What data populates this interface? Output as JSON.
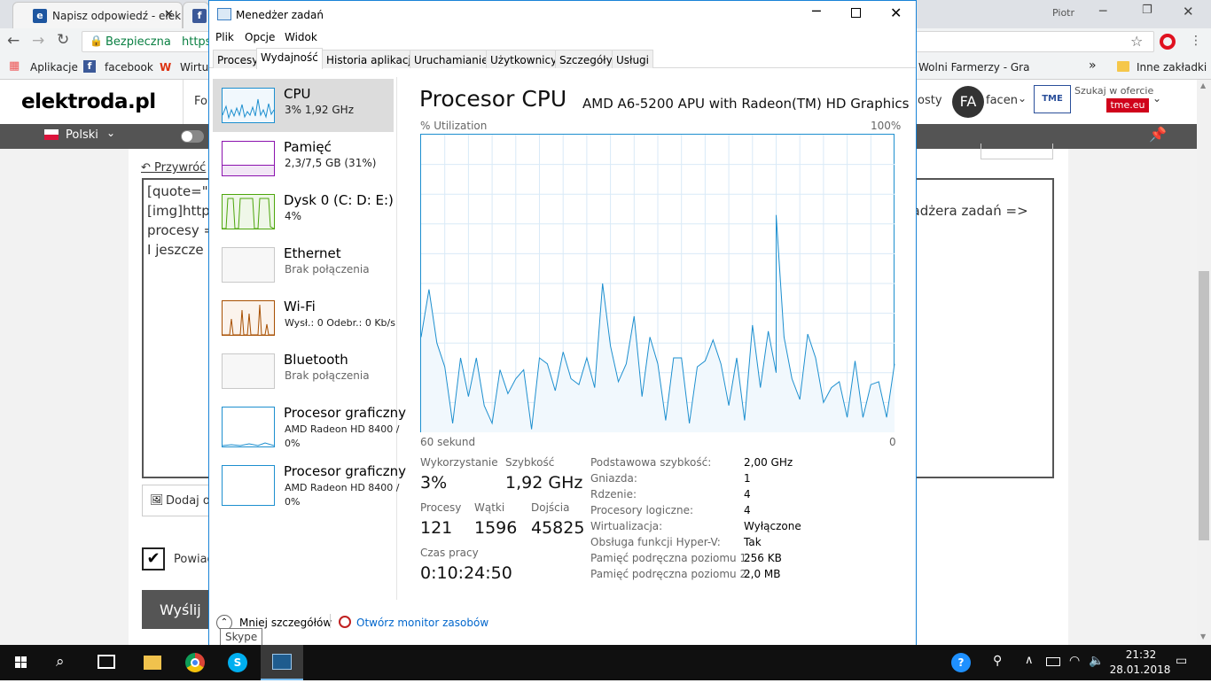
{
  "chrome": {
    "tabs": [
      {
        "title": "Napisz odpowiedź - elek"
      },
      {
        "title": "f"
      }
    ],
    "user": "Piotr",
    "secure_label": "Bezpieczna",
    "url_fragment": "https",
    "bookmarks": {
      "apps": "Aplikacje",
      "facebook": "facebook",
      "wirtua": "Wirtua",
      "wolni": "Wolni Farmerzy - Gra",
      "more": "»",
      "other": "Inne zakładki"
    }
  },
  "site": {
    "logo": "elektroda.pl",
    "nav_fo": "Fo",
    "nav_osty": "osty",
    "avatar": "FA",
    "username": "facen",
    "tme_search": "Szukaj w ofercie",
    "tme_badge": "tme.eu",
    "language": "Polski",
    "back_link": "Przywróć",
    "textarea_lines": [
      "[quote=\"fa",
      "[img]https",
      "procesy = ",
      "I jeszcze d"
    ],
    "textarea_tail": "nadżera zadań =>",
    "attach_label": "Dodaj o",
    "notify_label": "Powiad",
    "submit_label": "Wyślij"
  },
  "taskmgr": {
    "title": "Menedżer zadań",
    "menu": [
      "Plik",
      "Opcje",
      "Widok"
    ],
    "tabs": [
      "Procesy",
      "Wydajność",
      "Historia aplikacji",
      "Uruchamianie",
      "Użytkownicy",
      "Szczegóły",
      "Usługi"
    ],
    "sidebar": {
      "cpu": {
        "name": "CPU",
        "sub": "3%  1,92 GHz"
      },
      "memory": {
        "name": "Pamięć",
        "sub": "2,3/7,5 GB (31%)"
      },
      "disk": {
        "name": "Dysk 0 (C: D: E:)",
        "sub": "4%"
      },
      "ethernet": {
        "name": "Ethernet",
        "sub": "Brak połączenia"
      },
      "wifi": {
        "name": "Wi-Fi",
        "sub": "Wysł.: 0  Odebr.: 0 Kb/s"
      },
      "bluetooth": {
        "name": "Bluetooth",
        "sub": "Brak połączenia"
      },
      "gpu0": {
        "name": "Procesor graficzny",
        "model": "AMD Radeon HD 8400 /",
        "sub": "0%"
      },
      "gpu1": {
        "name": "Procesor graficzny",
        "model": "AMD Radeon HD 8400 /",
        "sub": "0%"
      }
    },
    "main": {
      "heading": "Procesor CPU",
      "model": "AMD A6-5200 APU with Radeon(TM) HD Graphics",
      "util_label": "% Utilization",
      "util_max": "100%",
      "time_label": "60 sekund",
      "time_min": "0",
      "stats": {
        "usage_label": "Wykorzystanie",
        "usage": "3%",
        "speed_label": "Szybkość",
        "speed": "1,92 GHz",
        "proc_label": "Procesy",
        "proc": "121",
        "threads_label": "Wątki",
        "threads": "1596",
        "handles_label": "Dojścia",
        "handles": "45825",
        "uptime_label": "Czas pracy",
        "uptime": "0:10:24:50"
      },
      "details": [
        {
          "k": "Podstawowa szybkość:",
          "v": "2,00 GHz"
        },
        {
          "k": "Gniazda:",
          "v": "1"
        },
        {
          "k": "Rdzenie:",
          "v": "4"
        },
        {
          "k": "Procesory logiczne:",
          "v": "4"
        },
        {
          "k": "Wirtualizacja:",
          "v": "Wyłączone"
        },
        {
          "k": "Obsługa funkcji Hyper-V:",
          "v": "Tak"
        },
        {
          "k": "Pamięć podręczna poziomu 1:",
          "v": "256 KB"
        },
        {
          "k": "Pamięć podręczna poziomu 2:",
          "v": "2,0 MB"
        }
      ]
    },
    "footer": {
      "less": "Mniej szczegółów",
      "monitor": "Otwórz monitor zasobów"
    },
    "tooltip": "Skype"
  },
  "chart_data": {
    "type": "area",
    "x": [
      60,
      59,
      58,
      57,
      56,
      55,
      54,
      53,
      52,
      51,
      50,
      49,
      48,
      47,
      46,
      45,
      44,
      43,
      42,
      41,
      40,
      39,
      38,
      37,
      36,
      35,
      34,
      33,
      32,
      31,
      30,
      29,
      28,
      27,
      26,
      25,
      24,
      23,
      22,
      21,
      20,
      19,
      18,
      17,
      16,
      15,
      15,
      14,
      13,
      12,
      11,
      10,
      9,
      8,
      7,
      6,
      5,
      4,
      3,
      2,
      1,
      0
    ],
    "values": [
      32,
      48,
      30,
      22,
      3,
      25,
      12,
      25,
      9,
      3,
      21,
      13,
      18,
      21,
      1,
      25,
      23,
      14,
      27,
      18,
      16,
      25,
      15,
      50,
      29,
      17,
      23,
      39,
      12,
      32,
      23,
      4,
      25,
      25,
      3,
      22,
      24,
      31,
      23,
      9,
      25,
      4,
      36,
      15,
      34,
      20,
      73,
      32,
      18,
      11,
      33,
      25,
      10,
      15,
      17,
      5,
      24,
      5,
      16,
      17,
      5,
      23
    ],
    "xlabel": "60 sekund",
    "ylabel": "% Utilization",
    "ylim": [
      0,
      100
    ],
    "xlim": [
      60,
      0
    ],
    "grid": true,
    "color": "#1d8fcf"
  },
  "taskbar": {
    "time": "21:32",
    "date": "28.01.2018"
  }
}
